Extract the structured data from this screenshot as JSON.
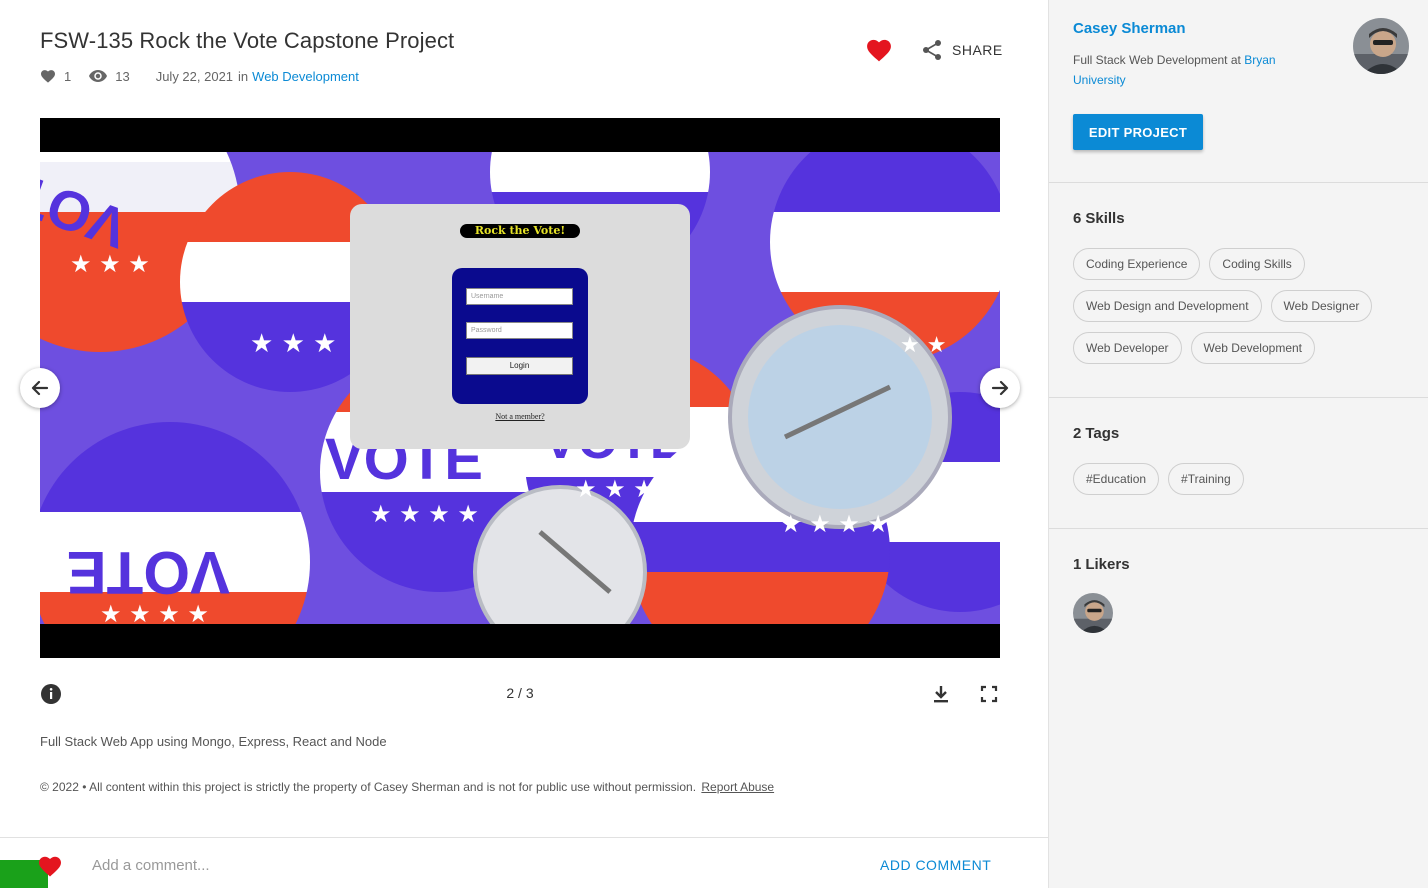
{
  "project": {
    "title": "FSW-135 Rock the Vote Capstone Project",
    "likes": "1",
    "views": "13",
    "date": "July 22, 2021",
    "in_label": "in",
    "category": "Web Development",
    "share_label": "SHARE"
  },
  "viewer": {
    "counter": "2 / 3",
    "slide": {
      "app_title": "Rock the Vote!",
      "username_placeholder": "Username",
      "password_placeholder": "Password",
      "login_label": "Login",
      "signup_link": "Not a member?",
      "button_word": "VOTE"
    }
  },
  "description": "Full Stack Web App using Mongo, Express, React and Node",
  "copyright": {
    "text": "© 2022 • All content within this project is strictly the property of Casey Sherman and is not for public use without permission.",
    "report_label": "Report Abuse"
  },
  "comment": {
    "placeholder": "Add a comment...",
    "submit_label": "ADD COMMENT"
  },
  "sidebar": {
    "owner_name": "Casey Sherman",
    "owner_role": "Full Stack Web Development at",
    "owner_school": "Bryan University",
    "edit_label": "EDIT PROJECT",
    "skills_count": "6",
    "skills_label": "Skills",
    "skills": [
      "Coding Experience",
      "Coding Skills",
      "Web Design and Development",
      "Web Designer",
      "Web Developer",
      "Web Development"
    ],
    "tags_count": "2",
    "tags_label": "Tags",
    "tags": [
      "#Education",
      "#Training"
    ],
    "likers_count": "1",
    "likers_label": "Likers"
  },
  "colors": {
    "accent": "#0b8ad5",
    "heart": "#e4151f",
    "green_block": "#1aa11a",
    "sidebar_bg": "#f4f4f4"
  },
  "icons": [
    "heart-icon",
    "eye-icon",
    "share-icon",
    "arrow-left-icon",
    "arrow-right-icon",
    "info-icon",
    "download-icon",
    "fullscreen-icon"
  ]
}
